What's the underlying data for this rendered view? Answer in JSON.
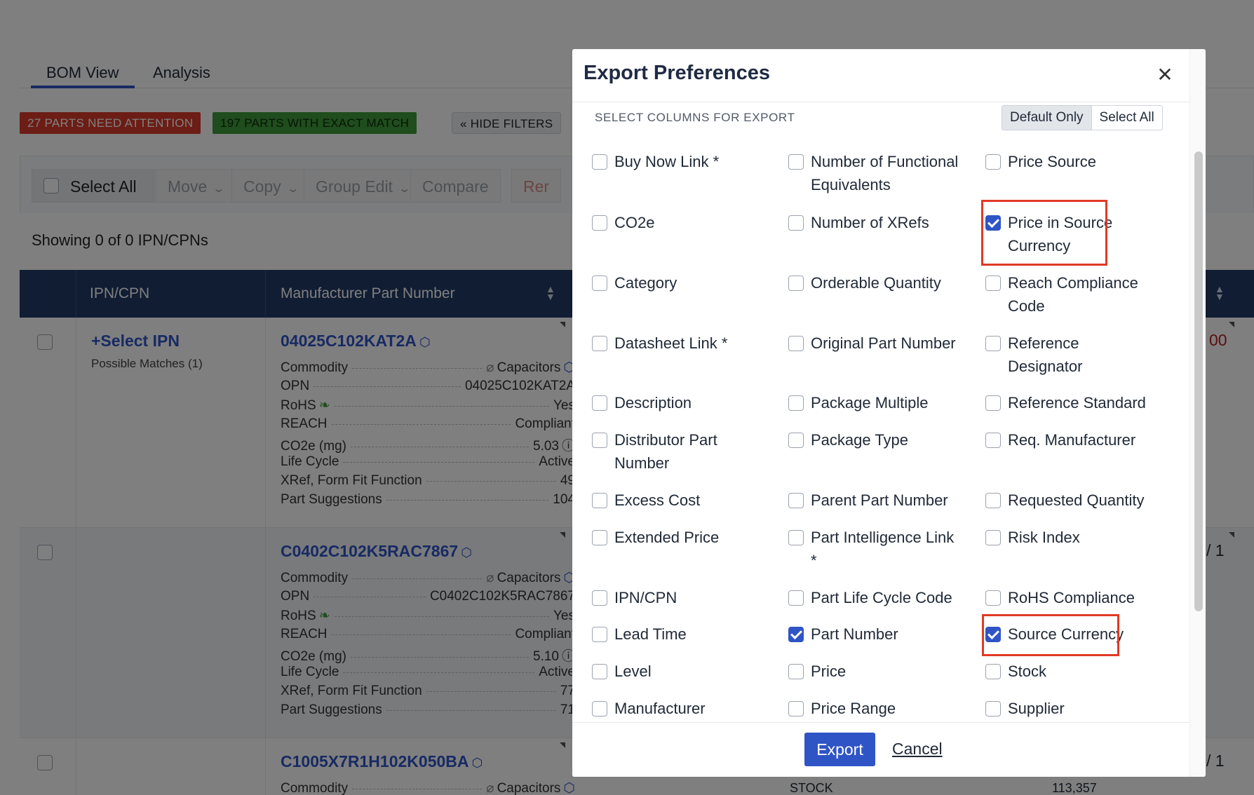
{
  "tabs": [
    "BOM View",
    "Analysis"
  ],
  "badges": {
    "attention": "27 PARTS NEED ATTENTION",
    "exact": "197 PARTS WITH EXACT MATCH",
    "hide_filters": "« HIDE FILTERS"
  },
  "toolbar": {
    "select_all": "Select All",
    "move": "Move",
    "copy": "Copy",
    "group_edit": "Group Edit",
    "compare": "Compare",
    "truncated": "Rer"
  },
  "showing": "Showing 0 of 0 IPN/CPNs",
  "table": {
    "col_ipn": "IPN/CPN",
    "col_mpn": "Manufacturer Part Number"
  },
  "rows": [
    {
      "select_ipn": "+Select IPN",
      "possible": "Possible Matches (1)",
      "part_number": "04025C102KAT2A",
      "specs": [
        {
          "k": "Commodity",
          "v": "Capacitors"
        },
        {
          "k": "OPN",
          "v": "04025C102KAT2A"
        },
        {
          "k": "RoHS",
          "v": "Yes"
        },
        {
          "k": "REACH",
          "v": "Compliant"
        },
        {
          "k": "CO2e (mg)",
          "v": "5.03"
        },
        {
          "k": "Life Cycle",
          "v": "Active"
        },
        {
          "k": "XRef, Form Fit Function",
          "v": "49"
        },
        {
          "k": "Part Suggestions",
          "v": "104"
        }
      ]
    },
    {
      "part_number": "C0402C102K5RAC7867",
      "specs": [
        {
          "k": "Commodity",
          "v": "Capacitors"
        },
        {
          "k": "OPN",
          "v": "C0402C102K5RAC7867"
        },
        {
          "k": "RoHS",
          "v": "Yes"
        },
        {
          "k": "REACH",
          "v": "Compliant"
        },
        {
          "k": "CO2e (mg)",
          "v": "5.10"
        },
        {
          "k": "Life Cycle",
          "v": "Active"
        },
        {
          "k": "XRef, Form Fit Function",
          "v": "77"
        },
        {
          "k": "Part Suggestions",
          "v": "71"
        }
      ]
    },
    {
      "part_number": "C1005X7R1H102K050BA",
      "specs": [
        {
          "k": "Commodity",
          "v": "Capacitors"
        }
      ]
    }
  ],
  "peek": {
    "r1": "00",
    "r2": "/ 1",
    "r3": "/ 1",
    "stock_label": "STOCK",
    "stock_value": "113,357"
  },
  "modal": {
    "title": "Export Preferences",
    "section_title": "SELECT COLUMNS FOR EXPORT",
    "default_only": "Default Only",
    "select_all": "Select All",
    "export": "Export",
    "cancel": "Cancel",
    "options": [
      {
        "label": "Buy Now Link *",
        "checked": false
      },
      {
        "label": "Number of Functional Equivalents",
        "checked": false
      },
      {
        "label": "Price Source",
        "checked": false
      },
      {
        "label": "CO2e",
        "checked": false
      },
      {
        "label": "Number of XRefs",
        "checked": false
      },
      {
        "label": "Price in Source Currency",
        "checked": true
      },
      {
        "label": "Category",
        "checked": false
      },
      {
        "label": "Orderable Quantity",
        "checked": false
      },
      {
        "label": "Reach Compliance Code",
        "checked": false
      },
      {
        "label": "Datasheet Link *",
        "checked": false
      },
      {
        "label": "Original Part Number",
        "checked": false
      },
      {
        "label": "Reference Designator",
        "checked": false
      },
      {
        "label": "Description",
        "checked": false
      },
      {
        "label": "Package Multiple",
        "checked": false
      },
      {
        "label": "Reference Standard",
        "checked": false
      },
      {
        "label": "Distributor Part Number",
        "checked": false
      },
      {
        "label": "Package Type",
        "checked": false
      },
      {
        "label": "Req. Manufacturer",
        "checked": false
      },
      {
        "label": "Excess Cost",
        "checked": false
      },
      {
        "label": "Parent Part Number",
        "checked": false
      },
      {
        "label": "Requested Quantity",
        "checked": false
      },
      {
        "label": "Extended Price",
        "checked": false
      },
      {
        "label": "Part Intelligence Link *",
        "checked": false
      },
      {
        "label": "Risk Index",
        "checked": false
      },
      {
        "label": "IPN/CPN",
        "checked": false
      },
      {
        "label": "Part Life Cycle Code",
        "checked": false
      },
      {
        "label": "RoHS Compliance",
        "checked": false
      },
      {
        "label": "Lead Time",
        "checked": false
      },
      {
        "label": "Part Number",
        "checked": true
      },
      {
        "label": "Source Currency",
        "checked": true
      },
      {
        "label": "Level",
        "checked": false
      },
      {
        "label": "Price",
        "checked": false
      },
      {
        "label": "Stock",
        "checked": false
      },
      {
        "label": "Manufacturer",
        "checked": false
      },
      {
        "label": "Price Range",
        "checked": false
      },
      {
        "label": "Supplier",
        "checked": false
      }
    ]
  },
  "colors": {
    "primary": "#2f54c6",
    "header_bg": "#213a67",
    "attention": "#d83b2b",
    "exact": "#3f9a3a",
    "highlight": "#e03a25"
  }
}
